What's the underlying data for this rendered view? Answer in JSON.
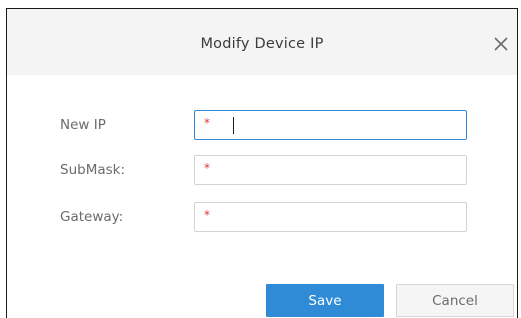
{
  "dialog": {
    "title": "Modify Device IP",
    "close_icon": "close-icon"
  },
  "form": {
    "new_ip": {
      "label": "New IP",
      "required_mark": "*",
      "value": ""
    },
    "submask": {
      "label": "SubMask:",
      "required_mark": "*",
      "value": ""
    },
    "gateway": {
      "label": "Gateway:",
      "required_mark": "*",
      "value": ""
    }
  },
  "buttons": {
    "save_label": "Save",
    "cancel_label": "Cancel"
  },
  "colors": {
    "accent": "#2f8bd6",
    "required": "#e03a3a",
    "titlebar": "#f4f4f4"
  }
}
